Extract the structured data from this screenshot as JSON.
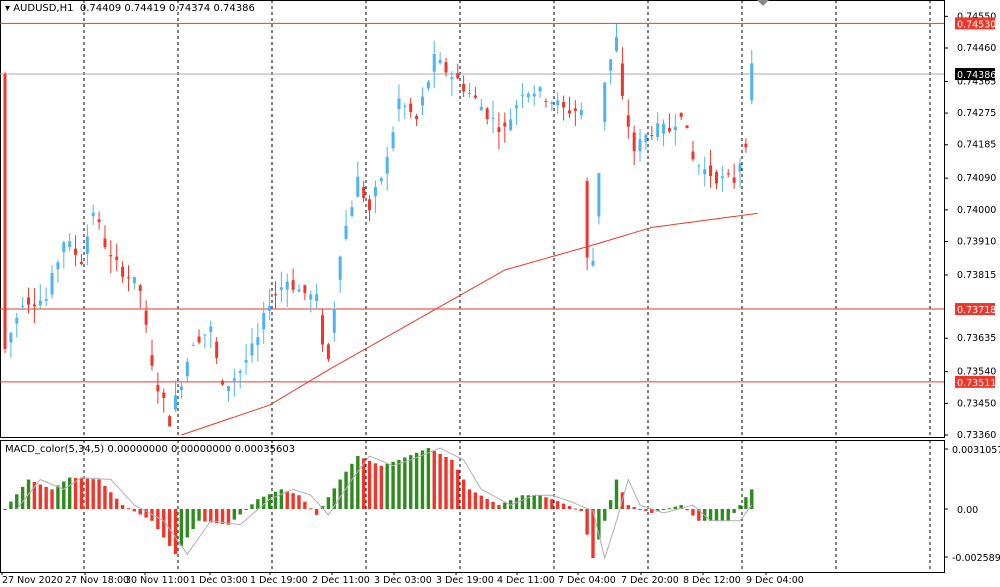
{
  "header": {
    "symbol": "AUDUSD,H1",
    "ohlc": "0.74409 0.74419 0.74374 0.74386"
  },
  "macd_header": {
    "name": "MACD_color(5,34,5)",
    "values": "0.00000000 0.00000000 0.00035603"
  },
  "colors": {
    "bull": "#4db3f5",
    "bear": "#f0352a",
    "macd_up": "#2e8b1e",
    "macd_down": "#f0352a",
    "ma": "#f0352a",
    "level": "#f0352a",
    "price_line": "#a0a8b8"
  },
  "chart_data": [
    {
      "type": "candlestick",
      "symbol": "AUDUSD",
      "timeframe": "H1",
      "price_ticks": [
        "0.74550",
        "0.74460",
        "0.74365",
        "0.74275",
        "0.74185",
        "0.74090",
        "0.74000",
        "0.73910",
        "0.73815",
        "0.73635",
        "0.73540",
        "0.73450",
        "0.73360"
      ],
      "ylim": [
        0.7336,
        0.7446
      ],
      "time_labels": [
        "27 Nov 2020",
        "27 Nov 18:00",
        "30 Nov 11:00",
        "1 Dec 03:00",
        "1 Dec 19:00",
        "2 Dec 11:00",
        "3 Dec 03:00",
        "3 Dec 19:00",
        "4 Dec 11:00",
        "7 Dec 04:00",
        "7 Dec 20:00",
        "8 Dec 12:00",
        "9 Dec 04:00"
      ],
      "levels": [
        {
          "price": "0.74530",
          "color": "red"
        },
        {
          "price": "0.73718",
          "color": "red"
        },
        {
          "price": "0.73511",
          "color": "red"
        }
      ],
      "current_price": "0.74386",
      "bars": 128,
      "close_path": [
        [
          0,
          0.73602
        ],
        [
          3,
          0.73744
        ],
        [
          7,
          0.73744
        ],
        [
          8,
          0.73801
        ],
        [
          10,
          0.73914
        ],
        [
          13,
          0.73857
        ],
        [
          15,
          0.73999
        ],
        [
          18,
          0.73857
        ],
        [
          20,
          0.73829
        ],
        [
          23,
          0.73772
        ],
        [
          25,
          0.73545
        ],
        [
          28,
          0.73403
        ],
        [
          30,
          0.73516
        ],
        [
          32,
          0.7363
        ],
        [
          35,
          0.73659
        ],
        [
          37,
          0.73488
        ],
        [
          40,
          0.73545
        ],
        [
          43,
          0.7363
        ],
        [
          45,
          0.73744
        ],
        [
          48,
          0.73801
        ],
        [
          50,
          0.73772
        ],
        [
          53,
          0.73744
        ],
        [
          54,
          0.7363
        ],
        [
          55,
          0.73573
        ],
        [
          57,
          0.73886
        ],
        [
          60,
          0.74085
        ],
        [
          62,
          0.73999
        ],
        [
          65,
          0.74141
        ],
        [
          67,
          0.74312
        ],
        [
          70,
          0.74255
        ],
        [
          73,
          0.74426
        ],
        [
          75,
          0.74397
        ],
        [
          77,
          0.74369
        ],
        [
          80,
          0.74312
        ],
        [
          83,
          0.74255
        ],
        [
          85,
          0.74227
        ],
        [
          88,
          0.7434
        ],
        [
          90,
          0.7434
        ],
        [
          93,
          0.74312
        ],
        [
          95,
          0.74284
        ],
        [
          98,
          0.74284
        ],
        [
          99,
          0.73857
        ],
        [
          100,
          0.73857
        ],
        [
          102,
          0.74369
        ],
        [
          104,
          0.74483
        ],
        [
          105,
          0.74312
        ],
        [
          107,
          0.7417
        ],
        [
          110,
          0.74227
        ],
        [
          113,
          0.74227
        ],
        [
          115,
          0.74284
        ],
        [
          117,
          0.74141
        ],
        [
          119,
          0.74113
        ],
        [
          122,
          0.74085
        ],
        [
          124,
          0.74085
        ],
        [
          126,
          0.74198
        ],
        [
          127,
          0.74397
        ],
        [
          128,
          0.74386
        ]
      ],
      "ma_path": [
        [
          30,
          0.7336
        ],
        [
          45,
          0.73445
        ],
        [
          55,
          0.73545
        ],
        [
          70,
          0.73687
        ],
        [
          85,
          0.73829
        ],
        [
          100,
          0.739
        ],
        [
          110,
          0.7395
        ],
        [
          128,
          0.7399
        ]
      ]
    },
    {
      "type": "histogram",
      "name": "MACD_color(5,34,5)",
      "ticks": [
        "0.0031057",
        "0.00",
        "-0.002589"
      ],
      "ylim": [
        -0.002589,
        0.0031057
      ],
      "path": [
        [
          0,
          0.0
        ],
        [
          4,
          0.0015
        ],
        [
          8,
          0.001
        ],
        [
          11,
          0.0016
        ],
        [
          16,
          0.0015
        ],
        [
          20,
          0.0002
        ],
        [
          25,
          -0.0006
        ],
        [
          29,
          -0.0023
        ],
        [
          33,
          -0.0006
        ],
        [
          38,
          -0.0008
        ],
        [
          43,
          0.0005
        ],
        [
          47,
          0.001
        ],
        [
          50,
          0.0007
        ],
        [
          53,
          -0.0003
        ],
        [
          57,
          0.0015
        ],
        [
          60,
          0.0027
        ],
        [
          64,
          0.0022
        ],
        [
          67,
          0.0025
        ],
        [
          72,
          0.0031
        ],
        [
          76,
          0.0025
        ],
        [
          79,
          0.001
        ],
        [
          84,
          0.0002
        ],
        [
          88,
          0.0007
        ],
        [
          91,
          0.0007
        ],
        [
          94,
          0.0004
        ],
        [
          98,
          -0.0001
        ],
        [
          100,
          -0.0025
        ],
        [
          102,
          -0.0006
        ],
        [
          104,
          0.0015
        ],
        [
          106,
          0.0002
        ],
        [
          110,
          -0.0002
        ],
        [
          115,
          0.0002
        ],
        [
          118,
          -0.0006
        ],
        [
          123,
          -0.0006
        ],
        [
          127,
          0.001
        ]
      ]
    }
  ]
}
